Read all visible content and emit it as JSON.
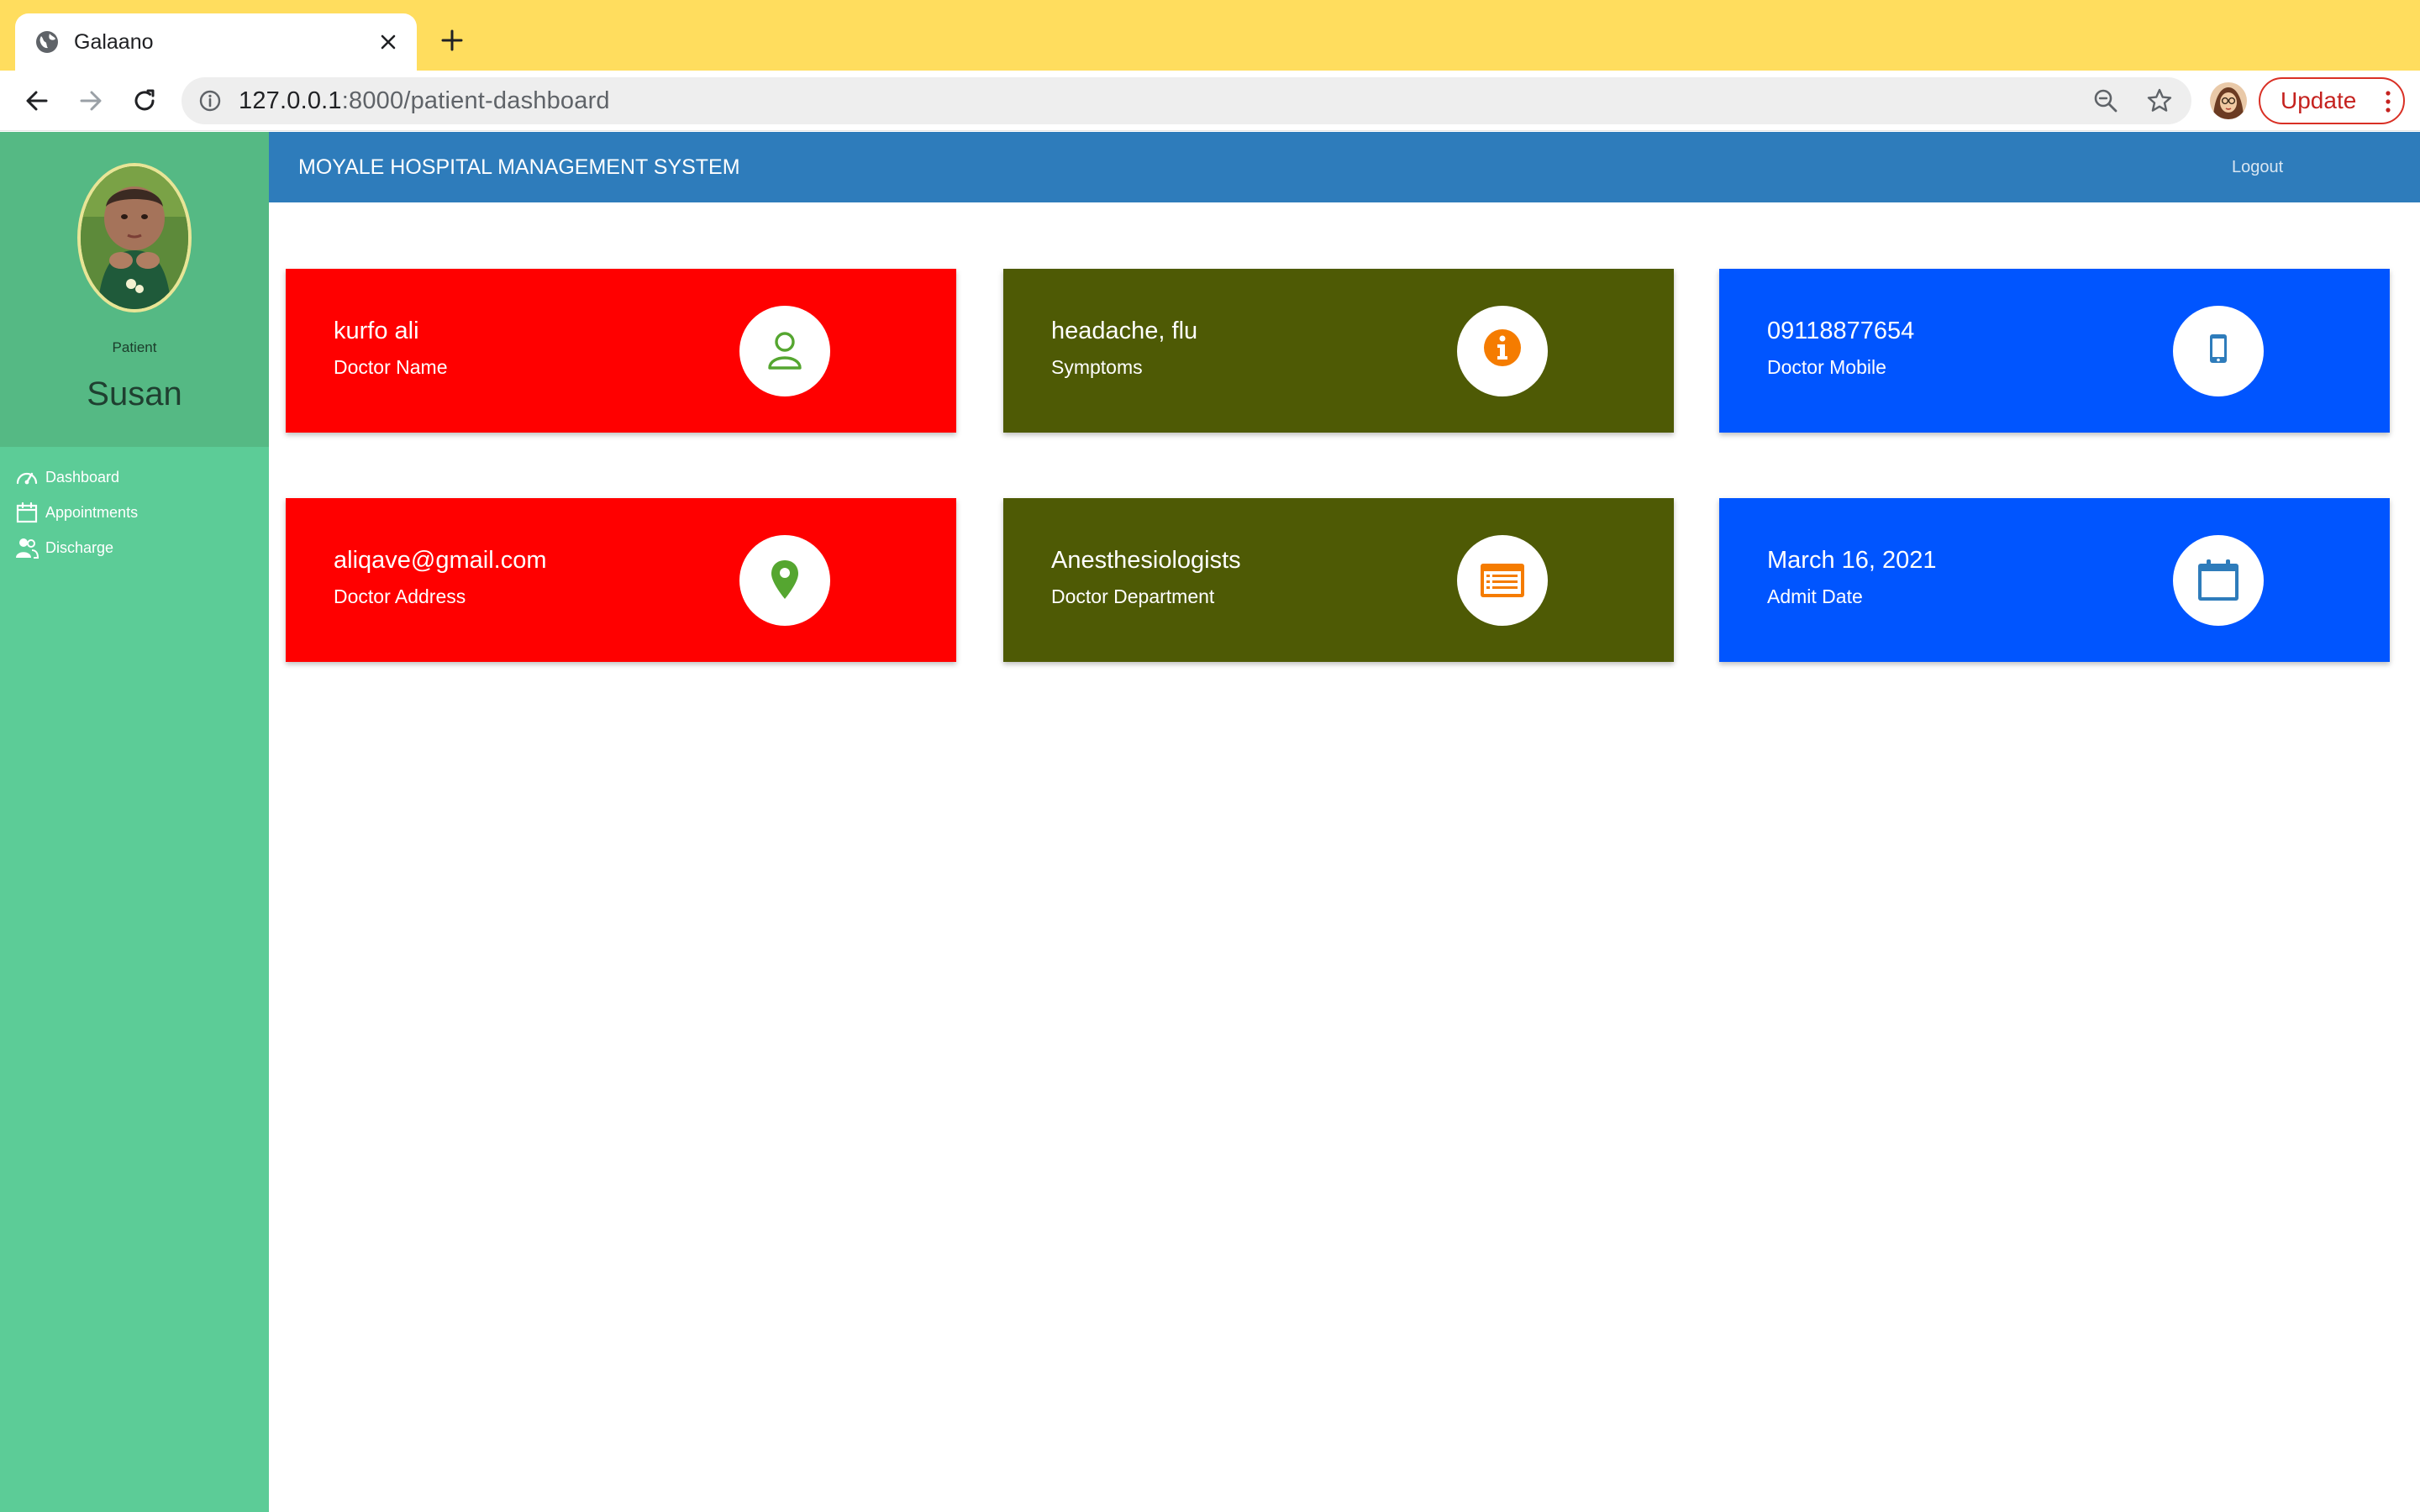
{
  "browser": {
    "tab_title": "Galaano",
    "url_host": "127.0.0.1",
    "url_rest": ":8000/patient-dashboard",
    "update_label": "Update"
  },
  "app": {
    "title": "MOYALE HOSPITAL MANAGEMENT SYSTEM",
    "logout_label": "Logout"
  },
  "sidebar": {
    "role": "Patient",
    "name": "Susan",
    "items": [
      {
        "label": "Dashboard",
        "icon": "gauge-icon"
      },
      {
        "label": "Appointments",
        "icon": "calendar-icon"
      },
      {
        "label": "Discharge",
        "icon": "users-icon"
      }
    ]
  },
  "cards": [
    {
      "value": "kurfo ali",
      "label": "Doctor Name",
      "color": "#ff0000",
      "icon": "user-icon",
      "icon_color": "#55a630"
    },
    {
      "value": "headache, flu",
      "label": "Symptoms",
      "color": "#4e5a05",
      "icon": "info-icon",
      "icon_color": "#f57c00"
    },
    {
      "value": "09118877654",
      "label": "Doctor Mobile",
      "color": "#0055ff",
      "icon": "mobile-icon",
      "icon_color": "#2e7cbb"
    },
    {
      "value": "aliqave@gmail.com",
      "label": "Doctor Address",
      "color": "#ff0000",
      "icon": "map-pin-icon",
      "icon_color": "#55a630"
    },
    {
      "value": "Anesthesiologists",
      "label": "Doctor Department",
      "color": "#4e5a05",
      "icon": "list-card-icon",
      "icon_color": "#f57c00"
    },
    {
      "value": "March 16, 2021",
      "label": "Admit Date",
      "color": "#0055ff",
      "icon": "calendar-icon",
      "icon_color": "#2e7cbb"
    }
  ]
}
